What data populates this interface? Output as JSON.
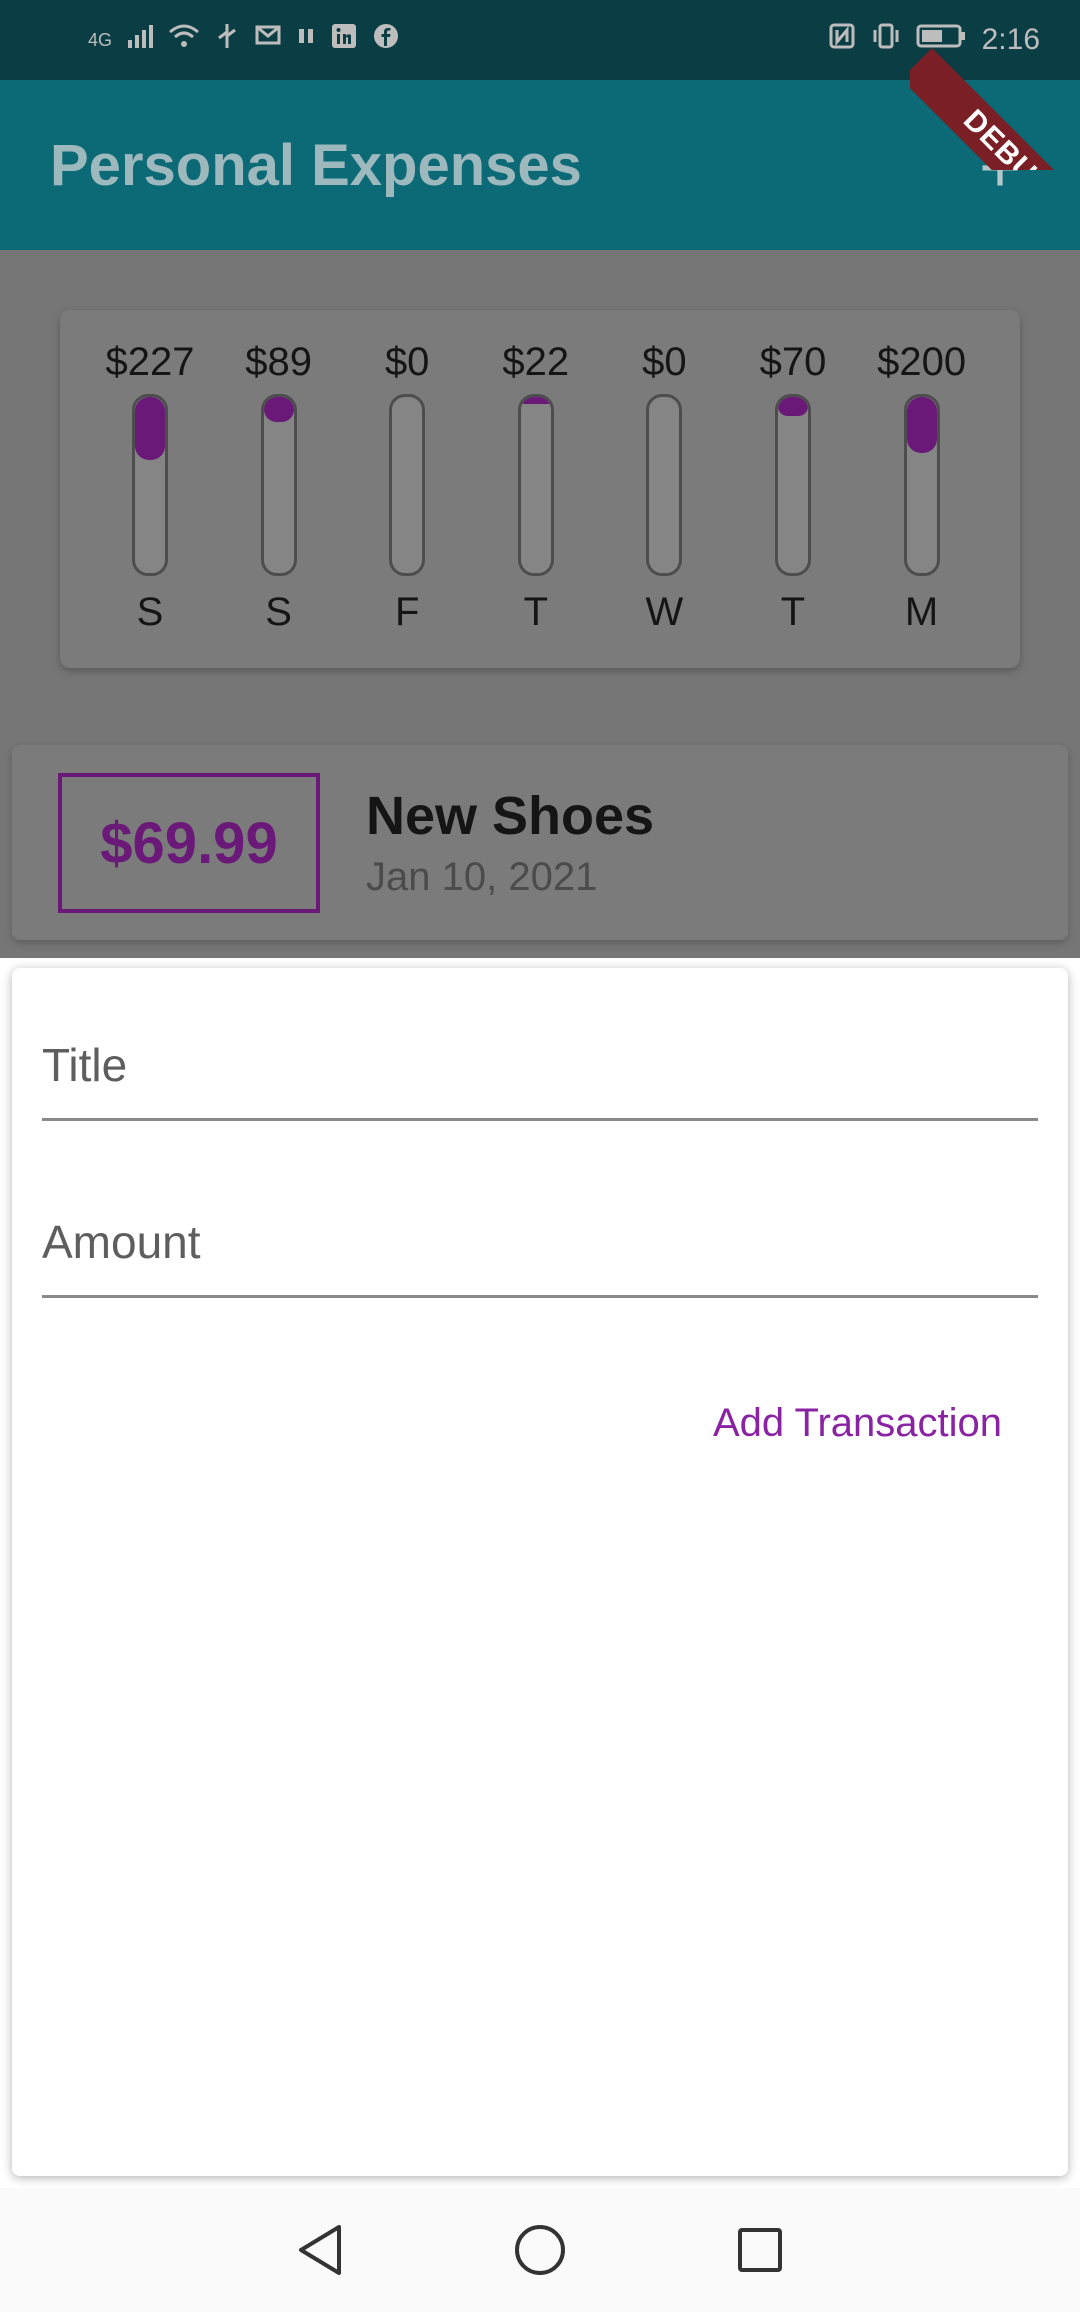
{
  "status_bar": {
    "network": "4G",
    "time": "2:16",
    "icons": [
      "signal-icon",
      "wifi-icon",
      "usb-icon",
      "message-icon",
      "pause-icon",
      "linkedin-icon",
      "facebook-icon",
      "nfc-icon",
      "vibrate-icon",
      "battery-icon"
    ]
  },
  "app_bar": {
    "title": "Personal Expenses",
    "add_label": "+"
  },
  "debug_banner": {
    "label": "DEBUG"
  },
  "chart": {
    "days": [
      {
        "day": "S",
        "amount": "$227",
        "fraction": 0.36
      },
      {
        "day": "S",
        "amount": "$89",
        "fraction": 0.14
      },
      {
        "day": "F",
        "amount": "$0",
        "fraction": 0.0
      },
      {
        "day": "T",
        "amount": "$22",
        "fraction": 0.035
      },
      {
        "day": "W",
        "amount": "$0",
        "fraction": 0.0
      },
      {
        "day": "T",
        "amount": "$70",
        "fraction": 0.11
      },
      {
        "day": "M",
        "amount": "$200",
        "fraction": 0.32
      }
    ],
    "accent_color": "#6a1979"
  },
  "transaction": {
    "amount": "$69.99",
    "title": "New Shoes",
    "date": "Jan 10, 2021"
  },
  "sheet": {
    "title_placeholder": "Title",
    "amount_placeholder": "Amount",
    "add_button_label": "Add Transaction",
    "accent_color": "#8a23a3"
  },
  "nav": {
    "items": [
      "back-icon",
      "home-icon",
      "recents-icon"
    ]
  }
}
